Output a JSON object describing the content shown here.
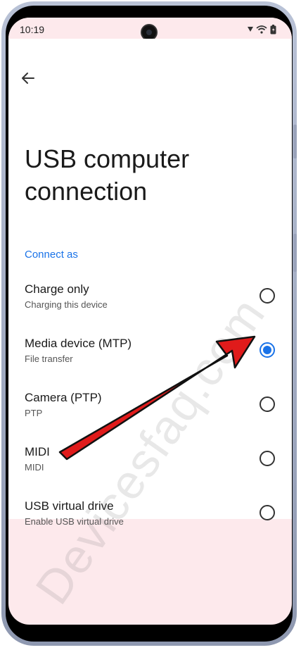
{
  "status_bar": {
    "time": "10:19"
  },
  "header": {
    "back_icon": "arrow-back-icon",
    "title": "USB computer connection"
  },
  "section": {
    "label": "Connect as"
  },
  "options": [
    {
      "title": "Charge only",
      "subtitle": "Charging this device",
      "selected": false
    },
    {
      "title": "Media device (MTP)",
      "subtitle": "File transfer",
      "selected": true
    },
    {
      "title": "Camera (PTP)",
      "subtitle": "PTP",
      "selected": false
    },
    {
      "title": "MIDI",
      "subtitle": "MIDI",
      "selected": false
    },
    {
      "title": "USB virtual drive",
      "subtitle": "Enable USB virtual drive",
      "selected": false
    }
  ],
  "watermark": "Devicesfaq.com",
  "colors": {
    "accent": "#1a73e8",
    "annotation_arrow": "#e01b1b",
    "system_bar_bg": "#fde9ec"
  }
}
